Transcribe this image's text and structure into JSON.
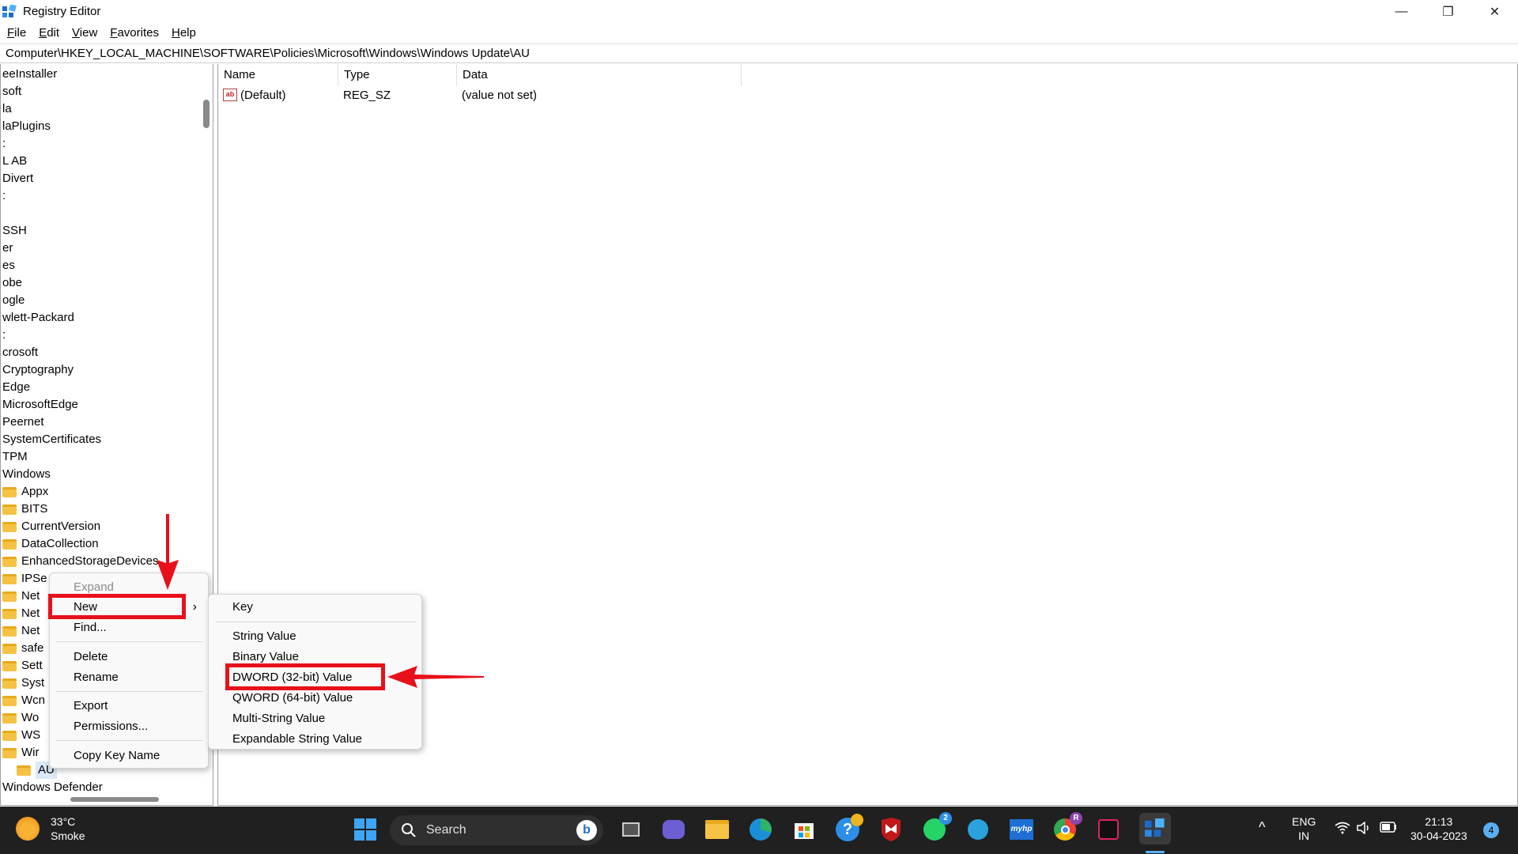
{
  "window": {
    "title": "Registry Editor",
    "minimize_glyph": "—",
    "maximize_glyph": "❐",
    "close_glyph": "✕"
  },
  "menu": [
    "File",
    "Edit",
    "View",
    "Favorites",
    "Help"
  ],
  "address": "Computer\\HKEY_LOCAL_MACHINE\\SOFTWARE\\Policies\\Microsoft\\Windows\\Windows Update\\AU",
  "tree": {
    "items": [
      {
        "label": "eeInstaller",
        "folder": false
      },
      {
        "label": "soft",
        "folder": false
      },
      {
        "label": "la",
        "folder": false
      },
      {
        "label": "laPlugins",
        "folder": false
      },
      {
        "label": ":",
        "folder": false
      },
      {
        "label": "L AB",
        "folder": false
      },
      {
        "label": "Divert",
        "folder": false
      },
      {
        "label": ":",
        "folder": false
      },
      {
        "label": "",
        "folder": false
      },
      {
        "label": "SSH",
        "folder": false
      },
      {
        "label": "er",
        "folder": false
      },
      {
        "label": "es",
        "folder": false
      },
      {
        "label": "obe",
        "folder": false
      },
      {
        "label": "ogle",
        "folder": false
      },
      {
        "label": "wlett-Packard",
        "folder": false
      },
      {
        "label": ":",
        "folder": false
      },
      {
        "label": "crosoft",
        "folder": false
      },
      {
        "label": "Cryptography",
        "folder": false
      },
      {
        "label": "Edge",
        "folder": false
      },
      {
        "label": "MicrosoftEdge",
        "folder": false
      },
      {
        "label": "Peernet",
        "folder": false
      },
      {
        "label": "SystemCertificates",
        "folder": false
      },
      {
        "label": "TPM",
        "folder": false
      },
      {
        "label": "Windows",
        "folder": false
      },
      {
        "label": "Appx",
        "folder": true
      },
      {
        "label": "BITS",
        "folder": true
      },
      {
        "label": "CurrentVersion",
        "folder": true
      },
      {
        "label": "DataCollection",
        "folder": true
      },
      {
        "label": "EnhancedStorageDevices",
        "folder": true
      },
      {
        "label": "IPSe",
        "folder": true
      },
      {
        "label": "Net",
        "folder": true
      },
      {
        "label": "Net",
        "folder": true
      },
      {
        "label": "Net",
        "folder": true
      },
      {
        "label": "safe",
        "folder": true
      },
      {
        "label": "Sett",
        "folder": true
      },
      {
        "label": "Syst",
        "folder": true
      },
      {
        "label": "Wcn",
        "folder": true
      },
      {
        "label": "Wo",
        "folder": true
      },
      {
        "label": "WS",
        "folder": true
      },
      {
        "label": "Wir",
        "folder": true
      },
      {
        "label": "AU",
        "folder": true,
        "selected": true
      },
      {
        "label": "Windows Defender",
        "folder": false
      }
    ]
  },
  "values_pane": {
    "columns": [
      "Name",
      "Type",
      "Data"
    ],
    "rows": [
      {
        "icon": "ab",
        "name": "(Default)",
        "type": "REG_SZ",
        "data": "(value not set)"
      }
    ]
  },
  "context_menu": {
    "items": [
      {
        "label": "Expand",
        "disabled": true
      },
      {
        "label": "New",
        "submenu": true,
        "submenu_glyph": "›"
      },
      {
        "label": "Find..."
      },
      {
        "label": "Delete"
      },
      {
        "label": "Rename"
      },
      {
        "label": "Export"
      },
      {
        "label": "Permissions..."
      },
      {
        "label": "Copy Key Name"
      }
    ]
  },
  "submenu": {
    "items": [
      "Key",
      "String Value",
      "Binary Value",
      "DWORD (32-bit) Value",
      "QWORD (64-bit) Value",
      "Multi-String Value",
      "Expandable String Value"
    ]
  },
  "taskbar": {
    "weather_temp": "33°C",
    "weather_desc": "Smoke",
    "search_label": "Search",
    "whatsapp_badge": "2",
    "chrome_badge": "R",
    "myhp_label": "myhp",
    "bing_label": "b",
    "lang_line1": "ENG",
    "lang_line2": "IN",
    "time": "21:13",
    "date": "30-04-2023",
    "notification_count": "4",
    "chevron_glyph": "^"
  },
  "colors": {
    "highlight_red": "#e8101a",
    "taskbar_bg": "#202020",
    "folder_yellow": "#f6c244",
    "selection_blue": "#d9e9f8"
  }
}
